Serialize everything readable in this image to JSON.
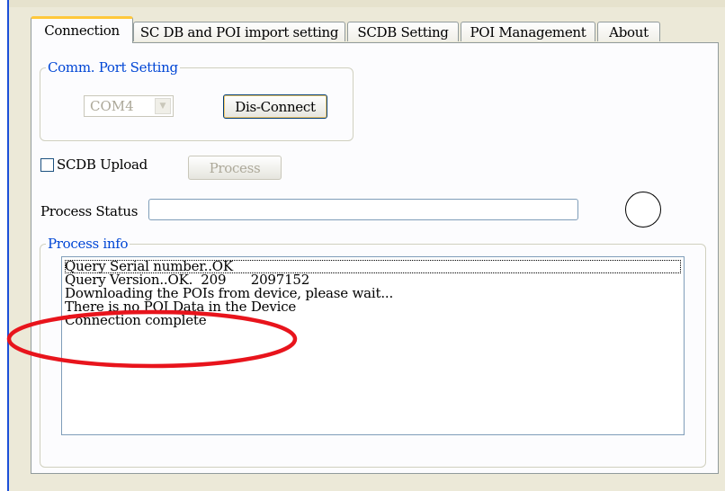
{
  "tabs": [
    {
      "label": "Connection",
      "active": true
    },
    {
      "label": "SC DB and POI import setting",
      "active": false
    },
    {
      "label": "SCDB  Setting",
      "active": false
    },
    {
      "label": "POI Management",
      "active": false
    },
    {
      "label": "About",
      "active": false
    }
  ],
  "comm_port": {
    "legend": "Comm. Port Setting",
    "selected_port": "COM4",
    "disconnect_label": "Dis-Connect"
  },
  "scdb_upload": {
    "checkbox_label": "SCDB Upload",
    "checked": false,
    "process_label": "Process"
  },
  "process_status": {
    "label": "Process Status",
    "value": ""
  },
  "process_info": {
    "legend": "Process info",
    "lines": [
      "Query Serial number..OK",
      "Query Version..OK.  209      2097152",
      "Downloading the POIs from device, please wait...",
      "There is no POI Data in the Device",
      "Connection complete"
    ]
  },
  "colors": {
    "window_bg": "#ece9d8",
    "legend_text": "#0046d5",
    "active_tab_highlight": "#ffc83c",
    "annotation_red": "#e8141c"
  }
}
